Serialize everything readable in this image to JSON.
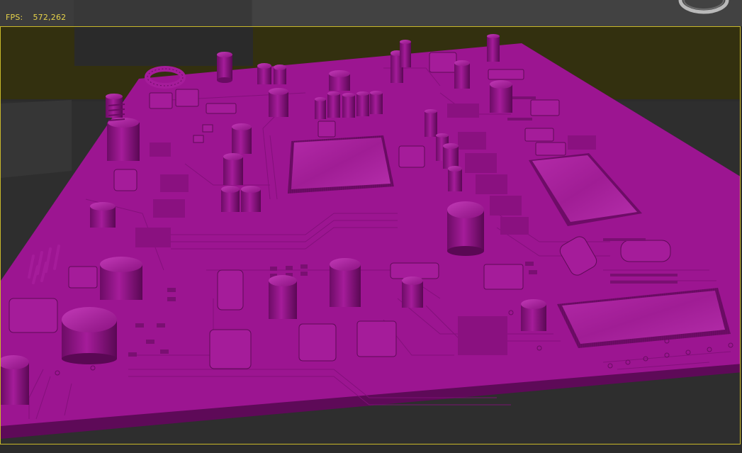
{
  "stats": {
    "fps_label": "FPS:",
    "fps_value": "572,262"
  },
  "viewport": {
    "border_color": "#c8b82a",
    "board_color": "#9c1591",
    "background_color": "#2e2e2e",
    "horizon_color": "#33300f"
  },
  "icons": {
    "viewcube": "viewcube-icon"
  }
}
